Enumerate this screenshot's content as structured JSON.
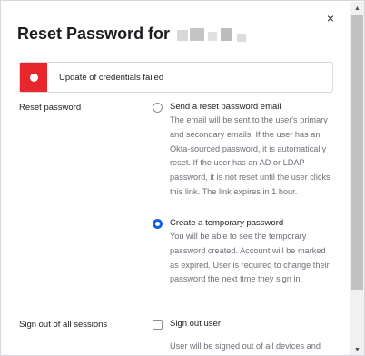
{
  "dialog": {
    "title": "Reset Password for",
    "close_icon": "×"
  },
  "alert": {
    "message": "Update of credentials failed",
    "color": "#e8262d"
  },
  "reset_password": {
    "label": "Reset password",
    "options": [
      {
        "label": "Send a reset password email",
        "selected": false,
        "description": "The email will be sent to the user's primary and secondary emails. If the user has an Okta-sourced password, it is automatically reset. If the user has an AD or LDAP password, it is not reset until the user clicks this link. The link expires in 1 hour."
      },
      {
        "label": "Create a temporary password",
        "selected": true,
        "description": "You will be able to see the temporary password created. Account will be marked as expired. User is required to change their password the next time they sign in."
      }
    ]
  },
  "sign_out": {
    "label": "Sign out of all sessions",
    "checkbox_label": "Sign out user",
    "checked": false,
    "description": "User will be signed out of all devices and"
  },
  "scrollbar": {
    "up_icon": "▲",
    "down_icon": "▼"
  },
  "colors": {
    "accent": "#1662dd",
    "error": "#e8262d"
  }
}
